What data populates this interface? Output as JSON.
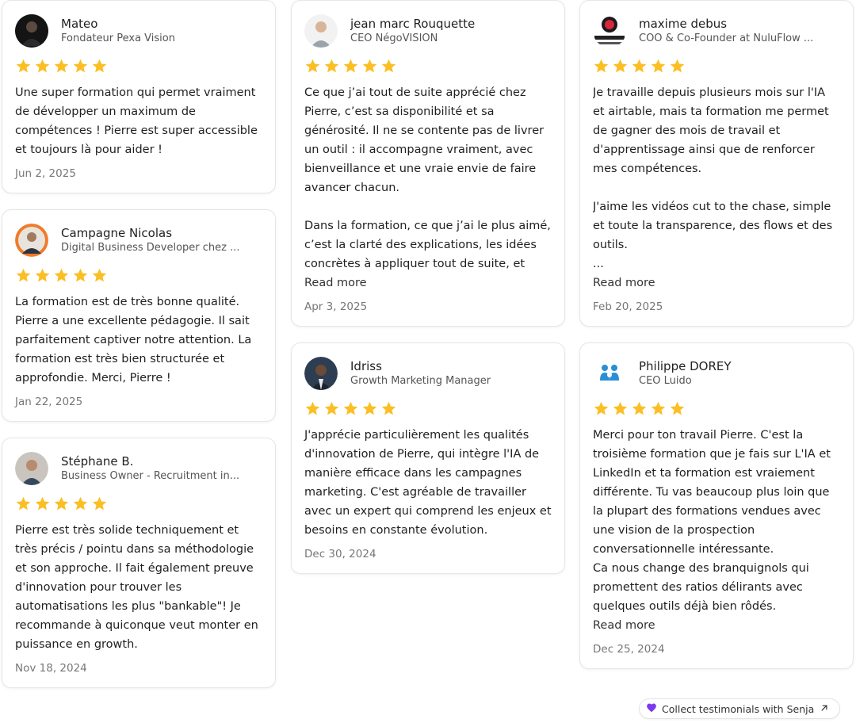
{
  "rating_stars": 5,
  "star_color": "#fbbf24",
  "reviews": [
    {
      "name": "Mateo",
      "title": "Fondateur Pexa Vision",
      "avatar_icon": "person-photo-icon",
      "text": "Une super formation qui permet vraiment de développer un maximum de compétences ! Pierre est super accessible et toujours là pour aider !",
      "date": "Jun 2, 2025"
    },
    {
      "name": "Campagne Nicolas",
      "title": "Digital Business Developer chez ...",
      "avatar_icon": "person-photo-icon",
      "text": "La formation est de très bonne qualité. Pierre a une excellente pédagogie. Il sait parfaitement captiver notre attention. La formation est très bien structurée et approfondie. Merci, Pierre !",
      "date": "Jan 22, 2025"
    },
    {
      "name": "Stéphane B.",
      "title": "Business Owner - Recruitment in...",
      "avatar_icon": "person-photo-icon",
      "text": "Pierre est très solide techniquement et très précis / pointu dans sa méthodologie et son approche. Il fait également preuve d'innovation pour trouver les automatisations les plus \"bankable\"! Je recommande à quiconque veut monter en puissance en growth.",
      "date": "Nov 18, 2024"
    },
    {
      "name": "jean marc Rouquette",
      "title": "CEO NégoVISION",
      "avatar_icon": "person-photo-icon",
      "text": "Ce que j’ai tout de suite apprécié chez Pierre, c’est sa disponibilité et sa générosité. Il ne se contente pas de livrer un outil : il accompagne vraiment, avec bienveillance et une vraie envie de faire avancer chacun.\n\nDans la formation, ce que j’ai le plus aimé, c’est la clarté des explications, les idées concrètes à appliquer tout de suite, et surtout la dynamique de la communauté....",
      "read_more": "Read more",
      "date": "Apr 3, 2025"
    },
    {
      "name": "Idriss",
      "title": "Growth Marketing Manager",
      "avatar_icon": "person-photo-icon",
      "text": "J'apprécie particulièrement les qualités d'innovation de Pierre, qui intègre l'IA de manière efficace dans les campagnes marketing. C'est agréable de travailler avec un expert qui comprend les enjeux et besoins en constante évolution.",
      "date": "Dec 30, 2024"
    },
    {
      "name": "maxime debus",
      "title": "COO & Co-Founder at NuluFlow ...",
      "avatar_icon": "company-logo-icon",
      "text": "Je travaille depuis plusieurs mois sur l'IA et airtable, mais ta formation me permet de gagner des mois de travail et d'apprentissage ainsi que de renforcer mes compétences.\n\nJ'aime les vidéos cut to the chase, simple et toute la transparence, des flows et des outils.\n...",
      "read_more": "Read more",
      "date": "Feb 20, 2025"
    },
    {
      "name": "Philippe DOREY",
      "title": "CEO Luido",
      "avatar_icon": "company-logo-icon",
      "text": "Merci pour ton travail Pierre. C'est la troisième formation que je fais sur L'IA et LinkedIn et ta formation est vraiement différente. Tu vas beaucoup plus loin que la plupart des formations vendues avec une vision de la prospection conversationnelle intéressante.\nCa nous change des branquignols qui promettent des ratios délirants avec quelques outils déjà bien rôdés.",
      "read_more": "Read more",
      "date": "Dec 25, 2024"
    }
  ],
  "footer": {
    "badge_label": "Collect testimonials with Senja",
    "badge_icon": "heart-icon",
    "arrow_icon": "external-arrow-icon",
    "heart_color": "#7c3aed"
  }
}
